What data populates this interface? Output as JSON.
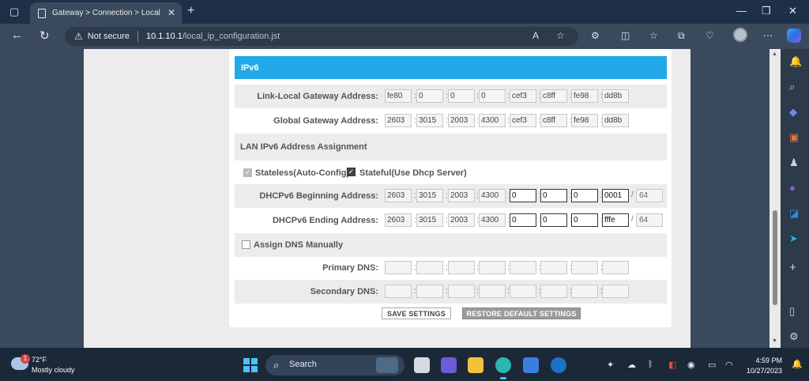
{
  "browser": {
    "tab_title": "Gateway > Connection > Local IP",
    "security_label": "Not secure",
    "url_host": "10.1.10.1",
    "url_path": "/local_ip_configuration.jst"
  },
  "ipv6": {
    "section_title": "IPv6",
    "link_local": {
      "label": "Link-Local Gateway Address:",
      "parts": [
        "fe80",
        "0",
        "0",
        "0",
        "cef3",
        "c8ff",
        "fe98",
        "dd8b"
      ]
    },
    "global": {
      "label": "Global Gateway Address:",
      "parts": [
        "2603",
        "3015",
        "2003",
        "4300",
        "cef3",
        "c8ff",
        "fe98",
        "dd8b"
      ]
    },
    "assignment_title": "LAN IPv6 Address Assignment",
    "stateless_label": "Stateless(Auto-Config)",
    "stateful_label": "Stateful(Use Dhcp Server)",
    "dhcp_begin": {
      "label": "DHCPv6 Beginning Address:",
      "parts": [
        "2603",
        "3015",
        "2003",
        "4300",
        "0",
        "0",
        "0",
        "0001"
      ],
      "prefix": "64"
    },
    "dhcp_end": {
      "label": "DHCPv6 Ending Address:",
      "parts": [
        "2603",
        "3015",
        "2003",
        "4300",
        "0",
        "0",
        "0",
        "fffe"
      ],
      "prefix": "64"
    },
    "dns_manual_label": "Assign DNS Manually",
    "primary_dns_label": "Primary DNS:",
    "secondary_dns_label": "Secondary DNS:",
    "save_label": "SAVE SETTINGS",
    "restore_label": "RESTORE DEFAULT SETTINGS"
  },
  "taskbar": {
    "temperature": "72°F",
    "weather": "Mostly cloudy",
    "weather_badge": "1",
    "search_label": "Search",
    "time": "4:59 PM",
    "date": "10/27/2023"
  },
  "colors": {
    "section_header": "#21a9e8",
    "restore_button": "#9a9a9a"
  }
}
